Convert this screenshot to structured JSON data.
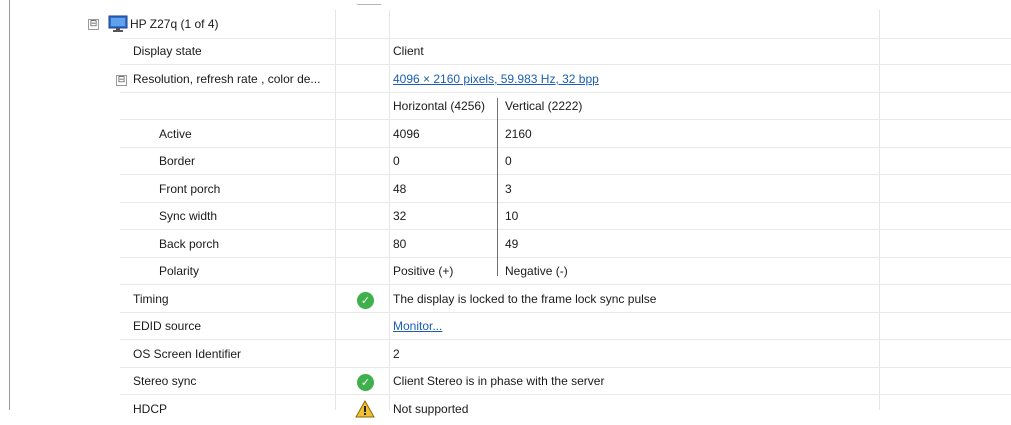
{
  "device": {
    "title": "HP Z27q (1 of 4)",
    "expander": "⊟",
    "icon": "monitor-icon"
  },
  "rows": {
    "display_state": {
      "label": "Display state",
      "value": "Client"
    },
    "resolution": {
      "expander": "⊟",
      "label": "Resolution, refresh rate , color de...",
      "value": "4096 × 2160 pixels, 59.983 Hz, 32 bpp"
    },
    "timing_header": {
      "horizontal": "Horizontal (4256)",
      "vertical": "Vertical (2222)"
    },
    "active": {
      "label": "Active",
      "h": "4096",
      "v": "2160"
    },
    "border": {
      "label": "Border",
      "h": "0",
      "v": "0"
    },
    "front_porch": {
      "label": "Front porch",
      "h": "48",
      "v": "3"
    },
    "sync_width": {
      "label": "Sync width",
      "h": "32",
      "v": "10"
    },
    "back_porch": {
      "label": "Back porch",
      "h": "80",
      "v": "49"
    },
    "polarity": {
      "label": "Polarity",
      "h": "Positive (+)",
      "v": "Negative (-)"
    },
    "timing": {
      "label": "Timing",
      "icon": "ok-icon",
      "value": "The display is locked to the frame lock sync pulse"
    },
    "edid_source": {
      "label": "EDID source",
      "value": "Monitor..."
    },
    "os_screen_id": {
      "label": "OS Screen Identifier",
      "value": "2"
    },
    "stereo_sync": {
      "label": "Stereo sync",
      "icon": "ok-icon",
      "value": "Client Stereo is in phase with the server"
    },
    "hdcp": {
      "label": "HDCP",
      "icon": "warning-icon",
      "value": "Not supported"
    }
  },
  "colors": {
    "link": "#1a5fb4",
    "ok": "#3fb14c",
    "warning": "#f2c037"
  }
}
